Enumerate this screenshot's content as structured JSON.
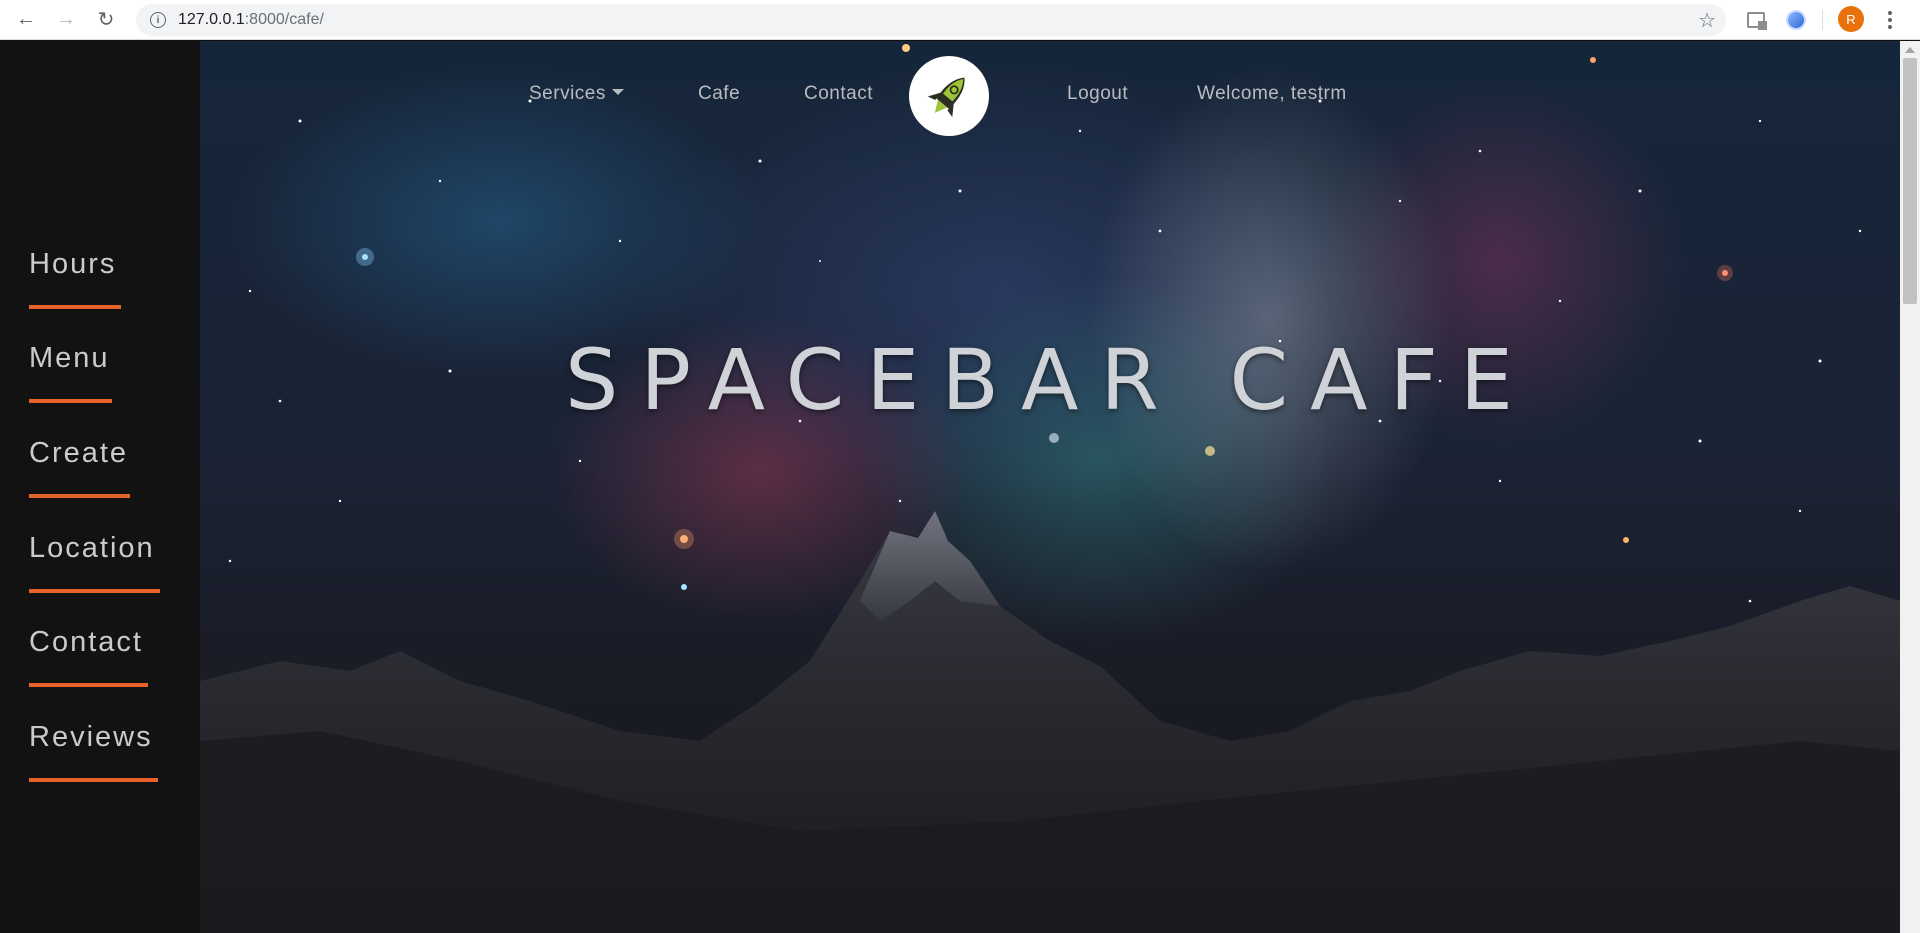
{
  "browser": {
    "url_host": "127.0.0.1",
    "url_rest": ":8000/cafe/",
    "profile_initial": "R"
  },
  "sidebar": {
    "items": [
      {
        "label": "Hours"
      },
      {
        "label": "Menu"
      },
      {
        "label": "Create"
      },
      {
        "label": "Location"
      },
      {
        "label": "Contact"
      },
      {
        "label": "Reviews"
      }
    ],
    "accent_color": "#e8632b"
  },
  "nav": {
    "services": "Services",
    "cafe": "Cafe",
    "contact": "Contact",
    "logout": "Logout",
    "welcome": "Welcome, testrm"
  },
  "hero": {
    "title": "SPACEBAR CAFE"
  },
  "icons": {
    "logo": "rocket-icon"
  }
}
